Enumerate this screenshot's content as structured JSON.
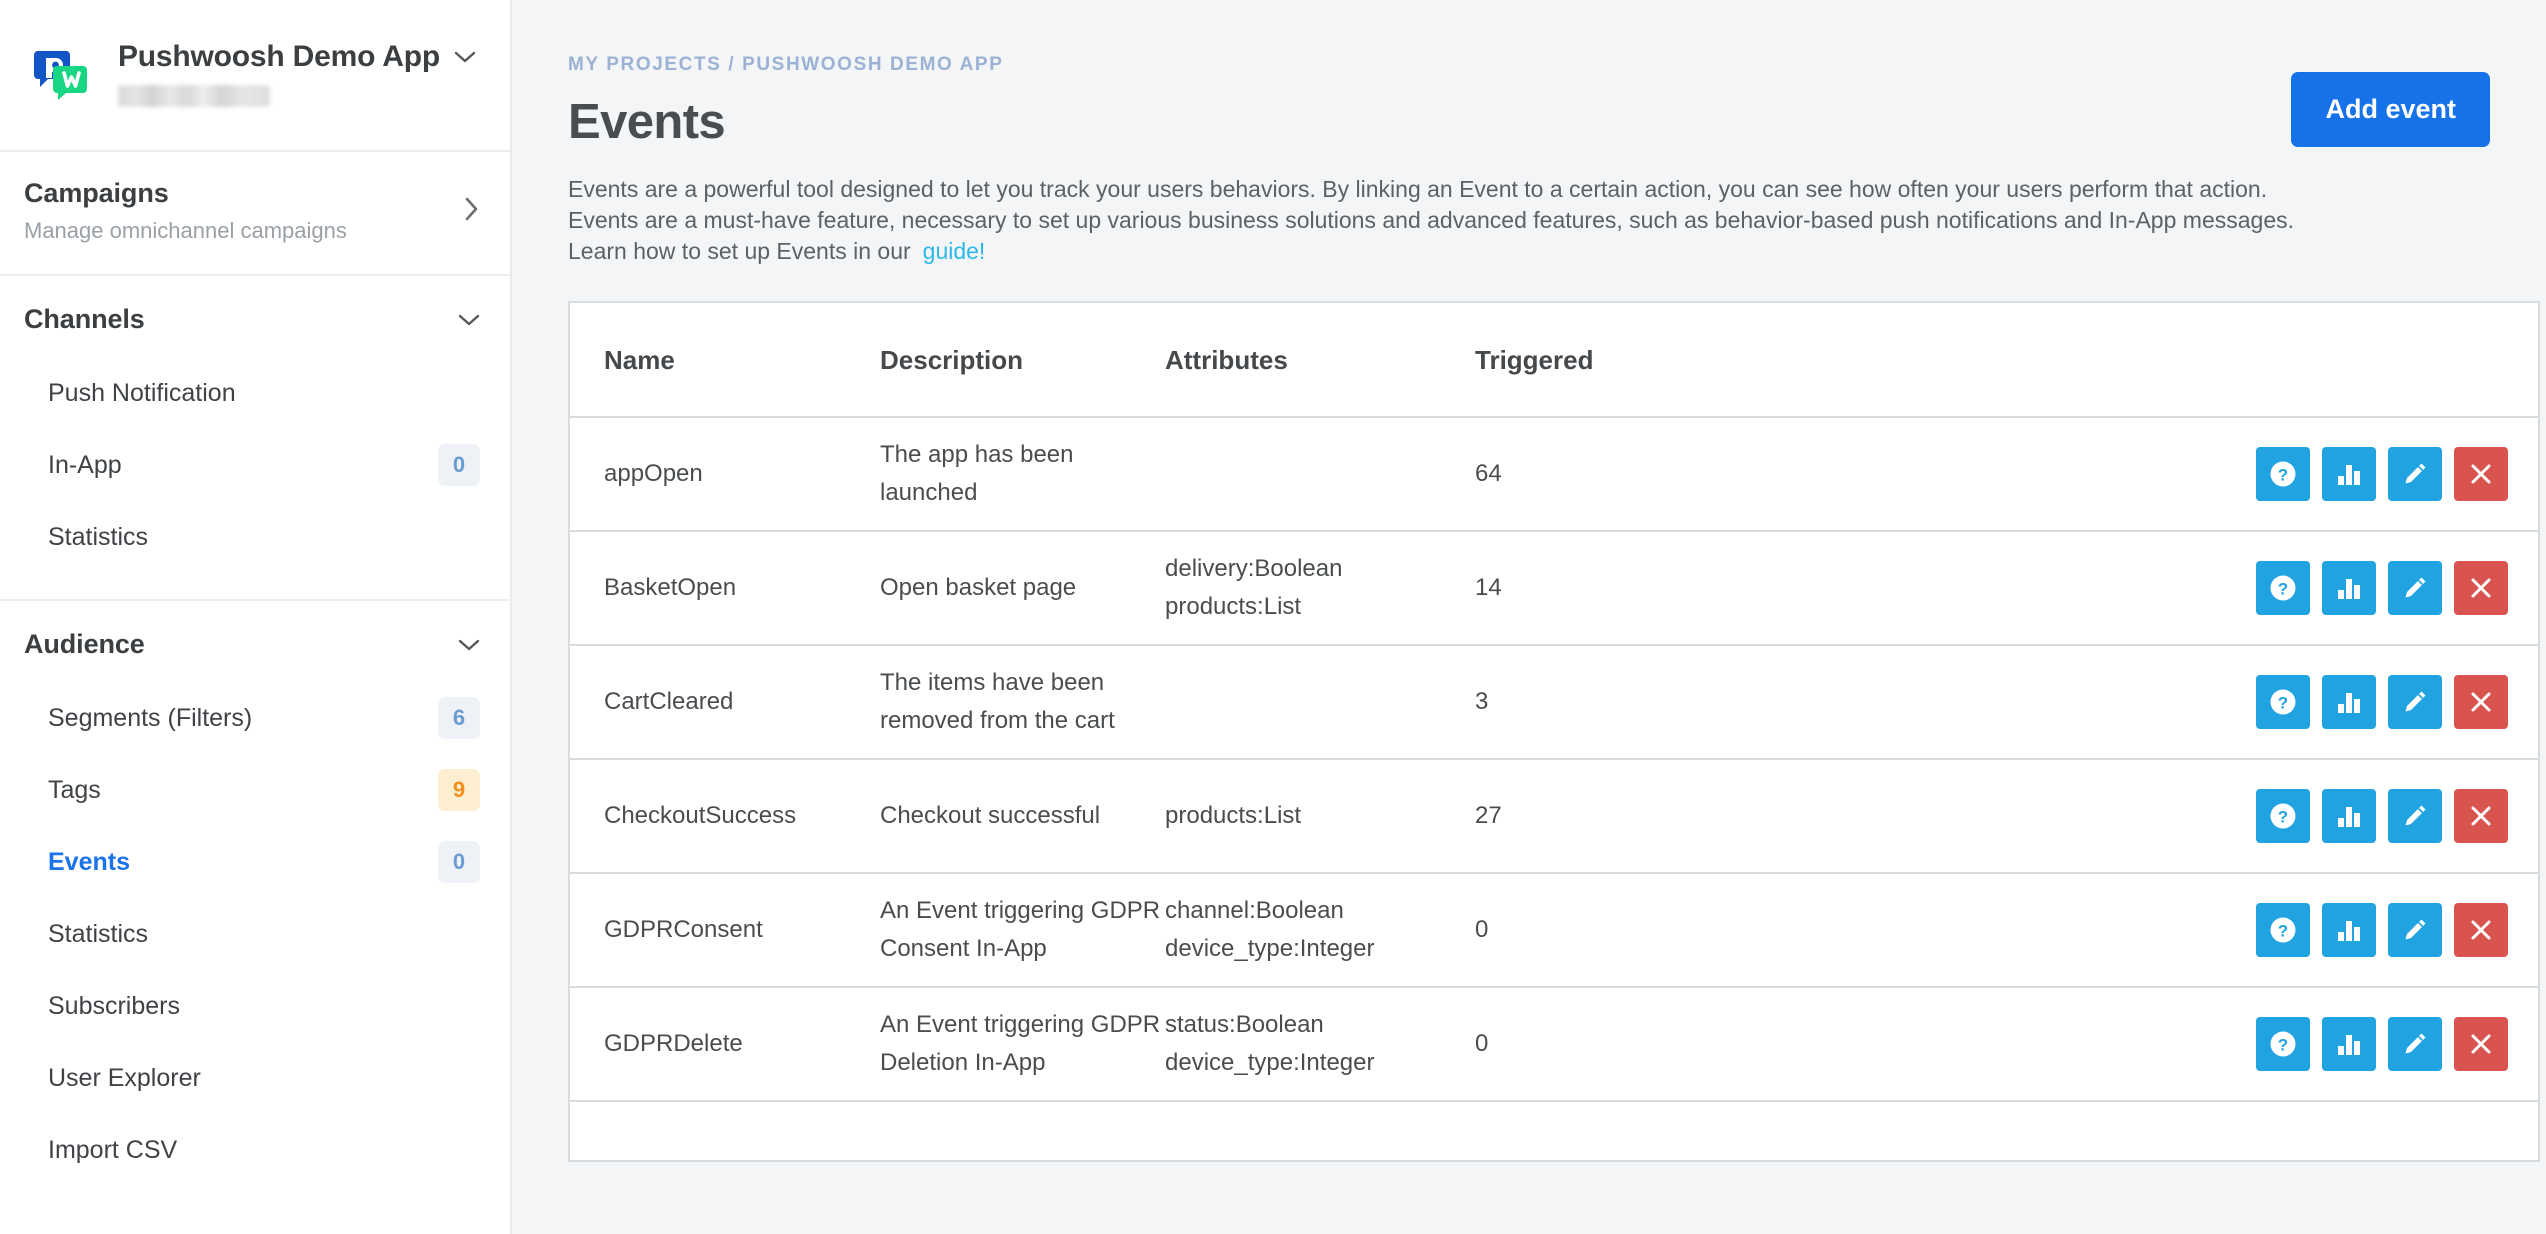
{
  "sidebar": {
    "app": {
      "name": "Pushwoosh Demo App",
      "logo_icon": "pushwoosh-logo",
      "dropdown_icon": "chevron-down-icon",
      "subtitle_redacted": true
    },
    "campaigns": {
      "title": "Campaigns",
      "subtitle": "Manage omnichannel campaigns",
      "chevron_icon": "chevron-right-icon"
    },
    "channels": {
      "title": "Channels",
      "chevron_icon": "chevron-down-icon",
      "items": [
        {
          "label": "Push Notification",
          "badge": null,
          "badge_color": null,
          "active": false
        },
        {
          "label": "In-App",
          "badge": "0",
          "badge_color": "#6c9bd2",
          "active": false
        },
        {
          "label": "Statistics",
          "badge": null,
          "badge_color": null,
          "active": false
        }
      ]
    },
    "audience": {
      "title": "Audience",
      "chevron_icon": "chevron-down-icon",
      "items": [
        {
          "label": "Segments (Filters)",
          "badge": "6",
          "badge_color": "#6c9bd2",
          "active": false
        },
        {
          "label": "Tags",
          "badge": "9",
          "badge_color": "#ef8f1c",
          "active": false
        },
        {
          "label": "Events",
          "badge": "0",
          "badge_color": "#6c9bd2",
          "active": true
        },
        {
          "label": "Statistics",
          "badge": null,
          "badge_color": null,
          "active": false
        },
        {
          "label": "Subscribers",
          "badge": null,
          "badge_color": null,
          "active": false
        },
        {
          "label": "User Explorer",
          "badge": null,
          "badge_color": null,
          "active": false
        },
        {
          "label": "Import CSV",
          "badge": null,
          "badge_color": null,
          "active": false
        }
      ]
    }
  },
  "main": {
    "breadcrumb": "MY PROJECTS / PUSHWOOSH DEMO APP",
    "title": "Events",
    "add_button": "Add event",
    "description": {
      "line1": "Events are a powerful tool designed to let you track your users behaviors. By linking an Event to a certain action, you can see how often your users perform that action.",
      "line2": "Events are a must-have feature, necessary to set up various business solutions and advanced features, such as behavior-based push notifications and In-App messages.",
      "line3": "Learn how to set up Events in our",
      "link": "guide!"
    },
    "table": {
      "columns": [
        "Name",
        "Description",
        "Attributes",
        "Triggered"
      ],
      "rows": [
        {
          "name": "appOpen",
          "description": [
            "The app has been launched"
          ],
          "attributes": [],
          "triggered": "64"
        },
        {
          "name": "BasketOpen",
          "description": [
            "Open basket page"
          ],
          "attributes": [
            "delivery:Boolean",
            "products:List"
          ],
          "triggered": "14"
        },
        {
          "name": "CartCleared",
          "description": [
            "The items have been",
            "removed from the cart"
          ],
          "attributes": [],
          "triggered": "3"
        },
        {
          "name": "CheckoutSuccess",
          "description": [
            "Checkout successful"
          ],
          "attributes": [
            "products:List"
          ],
          "triggered": "27"
        },
        {
          "name": "GDPRConsent",
          "description": [
            "An Event triggering GDPR",
            "Consent In-App"
          ],
          "attributes": [
            "channel:Boolean",
            "device_type:Integer"
          ],
          "triggered": "0"
        },
        {
          "name": "GDPRDelete",
          "description": [
            "An Event triggering GDPR",
            "Deletion In-App"
          ],
          "attributes": [
            "status:Boolean",
            "device_type:Integer"
          ],
          "triggered": "0"
        }
      ],
      "row_actions": [
        {
          "icon": "help-circle-icon",
          "color": "#21a3e1"
        },
        {
          "icon": "bar-chart-icon",
          "color": "#21a3e1"
        },
        {
          "icon": "pencil-edit-icon",
          "color": "#21a3e1"
        },
        {
          "icon": "close-x-icon",
          "color": "#d9534f"
        }
      ]
    }
  },
  "colors": {
    "accent_blue": "#1572e8",
    "action_blue": "#21a3e1",
    "action_red": "#d9534f",
    "link_cyan": "#2bb8ea",
    "active_nav": "#1a73e8",
    "badge_orange": "#ef8f1c",
    "page_bg": "#f4f5f6"
  }
}
